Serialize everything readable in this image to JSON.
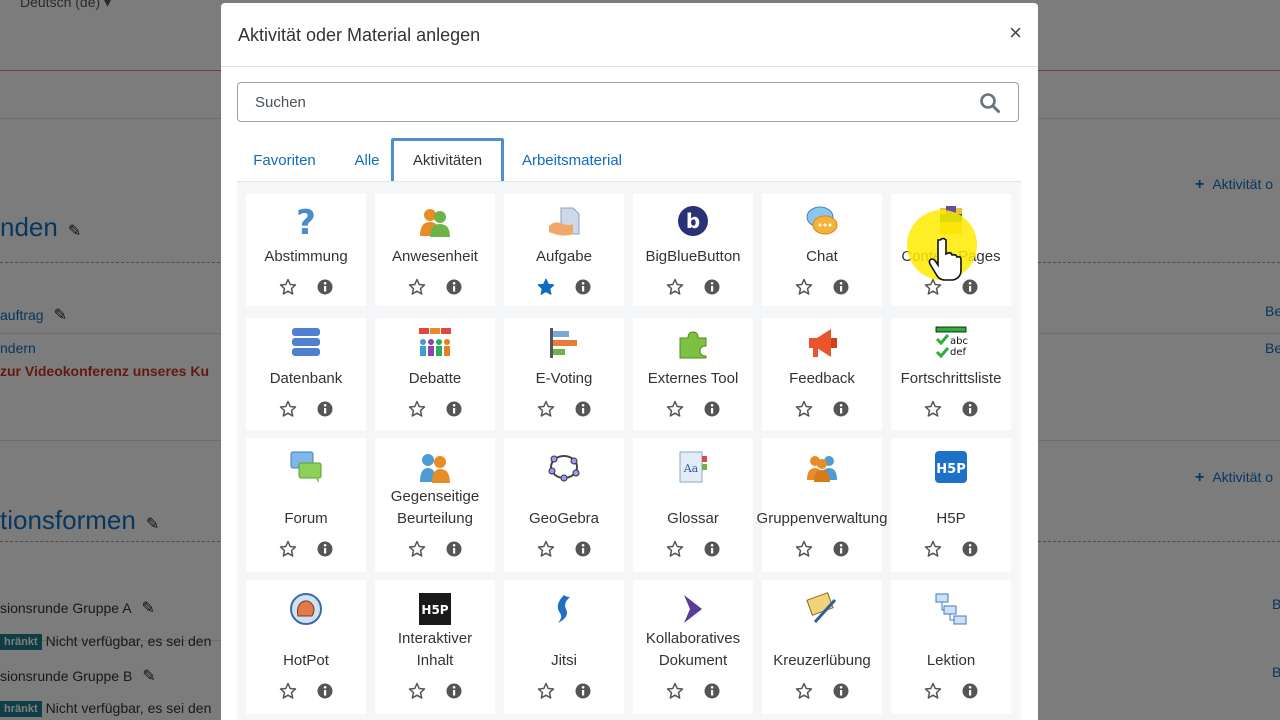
{
  "background": {
    "language": "Deutsch (de)",
    "section1_title": "nden",
    "item1": "auftrag",
    "item2": "ndern",
    "red_note": "zur Videokonferenz unseres Ku",
    "right_add_label": "Aktivität o",
    "right_link": "Be",
    "section2_title": "tionsformen",
    "group_a": "sionsrunde Gruppe A",
    "group_b": "sionsrunde Gruppe B",
    "badge": "hränkt",
    "restriction": "Nicht verfügbar, es sei den",
    "right_link2": "B"
  },
  "modal": {
    "title": "Aktivität oder Material anlegen",
    "close_label": "×",
    "search_placeholder": "Suchen",
    "tabs": [
      "Favoriten",
      "Alle",
      "Aktivitäten",
      "Arbeitsmaterial"
    ],
    "active_tab": "Aktivitäten",
    "activities": [
      {
        "name": "Abstimmung",
        "icon": "question-icon",
        "starred": false
      },
      {
        "name": "Anwesenheit",
        "icon": "attendance-icon",
        "starred": false
      },
      {
        "name": "Aufgabe",
        "icon": "assignment-icon",
        "starred": true
      },
      {
        "name": "BigBlueButton",
        "icon": "bigbluebutton-icon",
        "starred": false
      },
      {
        "name": "Chat",
        "icon": "chat-icon",
        "starred": false
      },
      {
        "name": "Content Pages",
        "icon": "content-pages-icon",
        "starred": false
      },
      {
        "name": "Datenbank",
        "icon": "database-icon",
        "starred": false
      },
      {
        "name": "Debatte",
        "icon": "debate-icon",
        "starred": false
      },
      {
        "name": "E-Voting",
        "icon": "evoting-icon",
        "starred": false
      },
      {
        "name": "Externes Tool",
        "icon": "puzzle-icon",
        "starred": false
      },
      {
        "name": "Feedback",
        "icon": "megaphone-icon",
        "starred": false
      },
      {
        "name": "Fortschrittsliste",
        "icon": "checklist-icon",
        "starred": false
      },
      {
        "name": "Forum",
        "icon": "forum-icon",
        "starred": false
      },
      {
        "name": "Gegenseitige Beurteilung",
        "icon": "workshop-icon",
        "starred": false
      },
      {
        "name": "GeoGebra",
        "icon": "geogebra-icon",
        "starred": false
      },
      {
        "name": "Glossar",
        "icon": "glossary-icon",
        "starred": false
      },
      {
        "name": "Gruppenverwaltung",
        "icon": "group-icon",
        "starred": false
      },
      {
        "name": "H5P",
        "icon": "h5p-icon",
        "starred": false
      },
      {
        "name": "HotPot",
        "icon": "hotpot-icon",
        "starred": false
      },
      {
        "name": "Interaktiver Inhalt",
        "icon": "h5p-dark-icon",
        "starred": false
      },
      {
        "name": "Jitsi",
        "icon": "jitsi-icon",
        "starred": false
      },
      {
        "name": "Kollaboratives Dokument",
        "icon": "collab-doc-icon",
        "starred": false
      },
      {
        "name": "Kreuzerlübung",
        "icon": "crossword-icon",
        "starred": false
      },
      {
        "name": "Lektion",
        "icon": "lesson-icon",
        "starred": false
      }
    ]
  },
  "colors": {
    "link": "#0f6cbf",
    "star_active": "#0f6cbf",
    "overlay": "#000000"
  }
}
